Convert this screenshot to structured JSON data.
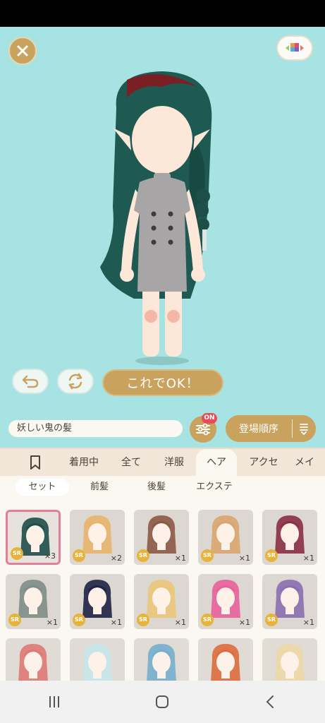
{
  "stage": {
    "ok_label": "これでOK！"
  },
  "filter": {
    "name_value": "妖しい鬼の髪",
    "on_badge": "ON",
    "sort_label": "登場順序"
  },
  "category_tabs": [
    "着用中",
    "全て",
    "洋服",
    "ヘア",
    "アクセ",
    "メイ"
  ],
  "active_category": "ヘア",
  "sub_tabs": [
    "セット",
    "前髪",
    "後髪",
    "エクステ"
  ],
  "active_sub_tab": "セット",
  "items": [
    {
      "rarity": "SR",
      "count": "×3",
      "hair": "#1e4e48",
      "selected": true
    },
    {
      "rarity": "SR",
      "count": "×2",
      "hair": "#e8b56a"
    },
    {
      "rarity": "SR",
      "count": "×1",
      "hair": "#8a5a44"
    },
    {
      "rarity": "SR",
      "count": "×1",
      "hair": "#d9a56e"
    },
    {
      "rarity": "SR",
      "count": "×1",
      "hair": "#8a2f46"
    },
    {
      "rarity": "SR",
      "count": "×1",
      "hair": "#7e8e86"
    },
    {
      "rarity": "SR",
      "count": "×1",
      "hair": "#1f2344"
    },
    {
      "rarity": "SR",
      "count": "×1",
      "hair": "#e9c77a"
    },
    {
      "rarity": "SR",
      "count": "×1",
      "hair": "#e8609a"
    },
    {
      "rarity": "SR",
      "count": "×1",
      "hair": "#8a6fb0"
    },
    {
      "rarity": "",
      "count": "",
      "hair": "#d9645e"
    },
    {
      "rarity": "",
      "count": "",
      "hair": "#bfe3e8"
    },
    {
      "rarity": "",
      "count": "",
      "hair": "#5fa3c7"
    },
    {
      "rarity": "",
      "count": "",
      "hair": "#d9541e"
    },
    {
      "rarity": "",
      "count": "",
      "hair": "#ead49a"
    }
  ],
  "colors": {
    "stage_bg": "#a6e3e2",
    "accent_gold": "#c9a25e",
    "badge_red": "#e94b5a",
    "selected_border": "#e07f97"
  },
  "icons": {
    "close": "close-icon",
    "menu": "palette-menu-icon",
    "undo": "undo-icon",
    "rotate": "rotate-icon",
    "filter": "sliders-icon",
    "sort": "sort-icon",
    "bookmark": "bookmark-icon",
    "recents": "recents-icon",
    "home": "home-icon",
    "back": "back-icon"
  }
}
